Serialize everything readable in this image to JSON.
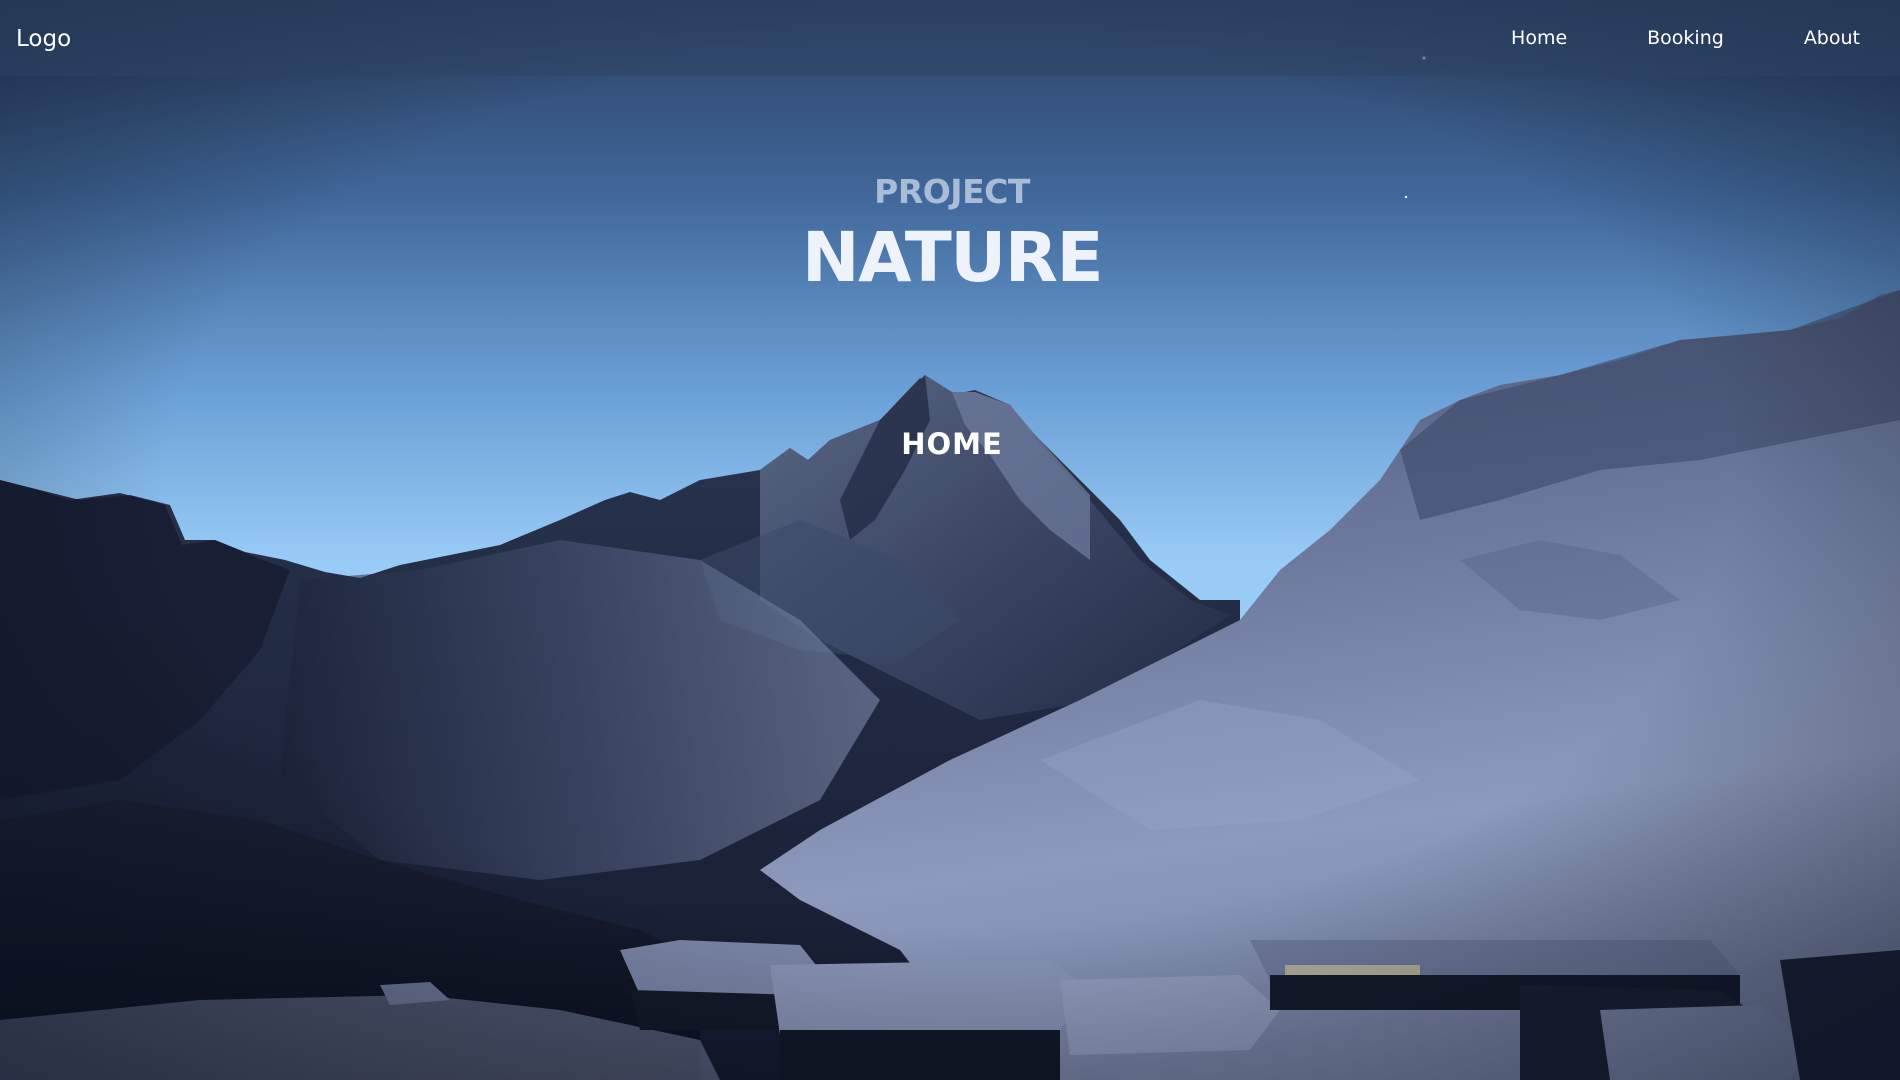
{
  "navbar": {
    "logo": "Logo",
    "links": [
      {
        "label": "Home"
      },
      {
        "label": "Booking"
      },
      {
        "label": "About"
      }
    ]
  },
  "hero": {
    "pretitle": "PROJECT",
    "title": "NATURE",
    "cta": "HOME"
  },
  "colors": {
    "navbar": "#2d4464",
    "sky_top": "#2a3f60",
    "sky_horizon": "#9acdf8",
    "mountain_dark": "#131b30",
    "snow": "#8f9cc0",
    "text": "#ffffff"
  }
}
